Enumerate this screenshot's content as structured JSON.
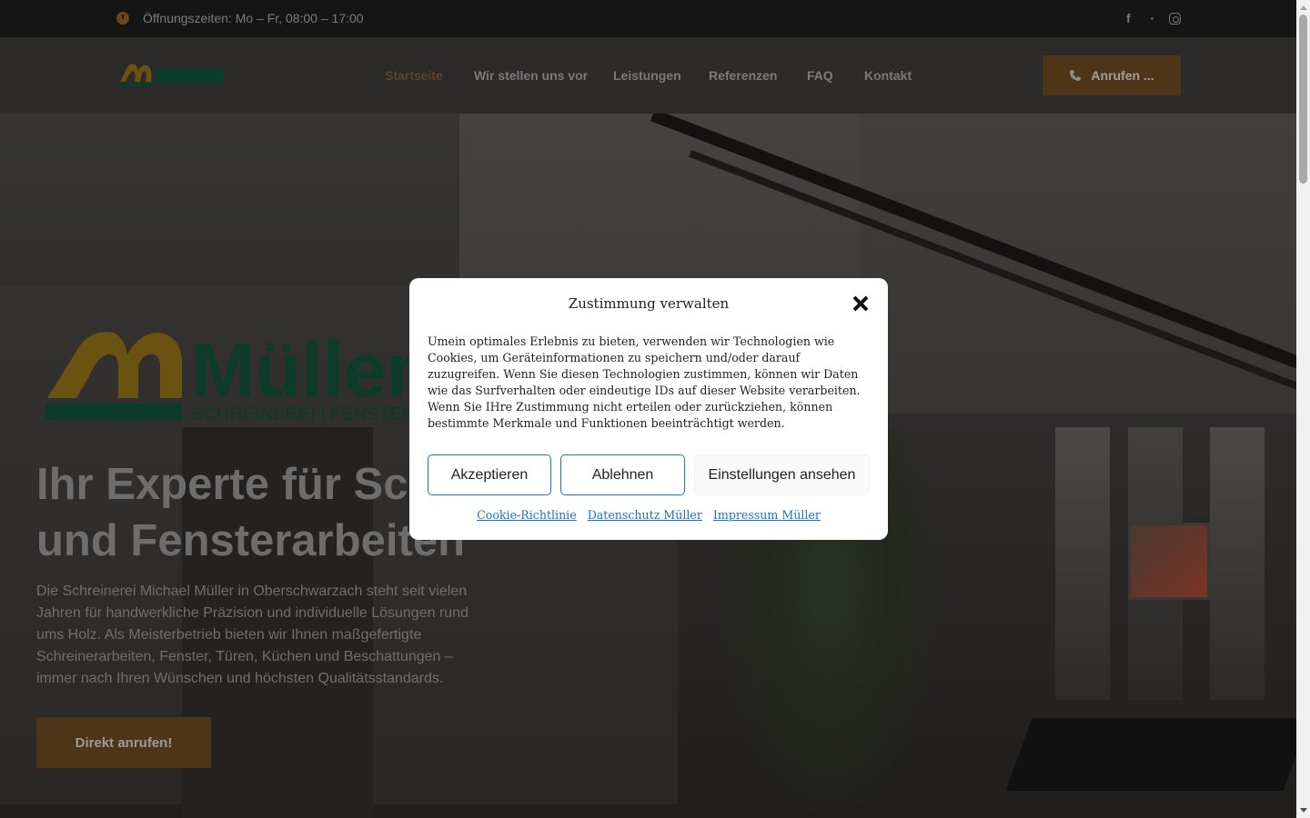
{
  "topbar": {
    "hours": "Öffnungszeiten: Mo – Fr, 08:00 – 17:00"
  },
  "nav": {
    "items": [
      "Startseite",
      "Wir stellen uns vor",
      "Leistungen",
      "Referenzen",
      "FAQ",
      "Kontakt"
    ],
    "active": "Startseite",
    "call_button": "Anrufen ..."
  },
  "hero": {
    "title_line1": "Ihr Experte für Schreiner-",
    "title_line2": "und Fensterarbeiten",
    "text": "Die Schreinerei Michael Müller in Oberschwarzach steht seit vielen Jahren für handwerkliche Präzision und individuelle Lösungen rund ums Holz. Als Meisterbetrieb bieten wir Ihnen maßgefertigte Schreinerarbeiten, Fenster, Türen, Küchen und Beschattungen – immer nach Ihren Wünschen und höchsten Qualitätsstandards.",
    "cta": "Direkt anrufen!",
    "logo_text": "Müller",
    "logo_sub": "SCHREINEREI | FENSTER"
  },
  "modal": {
    "title": "Zustimmung verwalten",
    "body": "Umein optimales Erlebnis zu bieten, verwenden wir Technologien wie Cookies, um Geräteinformationen zu speichern und/oder darauf zuzugreifen. Wenn Sie diesen Technologien zustimmen, können wir Daten wie das Surfverhalten oder eindeutige IDs auf dieser Website verarbeiten. Wenn Sie IHre Zustimmung nicht erteilen oder zurückziehen, können bestimmte Merkmale und Funktionen beeinträchtigt werden.",
    "accept": "Akzeptieren",
    "deny": "Ablehnen",
    "settings": "Einstellungen ansehen",
    "links": [
      "Cookie-Richtlinie",
      "Datenschutz Müller",
      "Impressum Müller"
    ]
  },
  "colors": {
    "accent": "#4f3517",
    "logo_gold": "#6a5310",
    "logo_green": "#0d3b2b",
    "link": "#1e73be"
  }
}
